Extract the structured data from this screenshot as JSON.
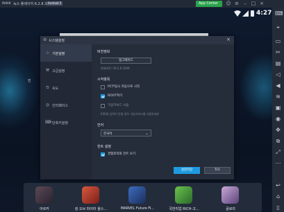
{
  "titlebar": {
    "logo": "nox",
    "title": "녹스 플레이어 6.2.8.3",
    "android_badge": "Android 5",
    "app_center": "App Center"
  },
  "status": {
    "time": "4:27"
  },
  "dialog": {
    "title": "시스템설정",
    "nav": [
      {
        "label": "기본설정",
        "icon": "gear-icon"
      },
      {
        "label": "고급설정",
        "icon": "sliders-icon"
      },
      {
        "label": "속도",
        "icon": "gauge-icon"
      },
      {
        "label": "인터페이스",
        "icon": "monitor-icon"
      },
      {
        "label": "단축키설정",
        "icon": "keyboard-icon"
      }
    ],
    "version": {
      "heading": "버전정보",
      "upgrade_button": "업그레이드",
      "current_version": "현재버전: V6.2.8.3008"
    },
    "startup": {
      "heading": "시작항목",
      "options": [
        {
          "label": "PC부팅시 자동으로 시작",
          "checked": false,
          "disabled": false
        },
        {
          "label": "ROOT켜기",
          "checked": true,
          "disabled": false
        },
        {
          "label": "가상키보드 사용",
          "checked": false,
          "disabled": true
        }
      ],
      "note": "EXE형 입력이 안될 경우 가상키보드를 사용하세요"
    },
    "language": {
      "heading": "언어",
      "selected": "한국어"
    },
    "hints": {
      "heading": "힌트 설정",
      "option": {
        "label": "경험최적화 힌트 보기",
        "checked": true
      }
    },
    "save_button": "설정저장",
    "cancel_button": "취소"
  },
  "desktop": {
    "left_label": "인"
  },
  "dock": {
    "apps": [
      {
        "label": "아르카",
        "color": "#3b2e3a"
      },
      {
        "label": "킹 오브 파이터 올스...",
        "color": "#b23a2c"
      },
      {
        "label": "MARVEL Future Fi...",
        "color": "#2b4a86"
      },
      {
        "label": "국한직업 RICH-고...",
        "color": "#3e8f3a"
      },
      {
        "label": "글로리",
        "color": "#8a6a9e"
      }
    ]
  },
  "colors": {
    "accent": "#1e9be0",
    "app_center": "#2aa34b"
  }
}
